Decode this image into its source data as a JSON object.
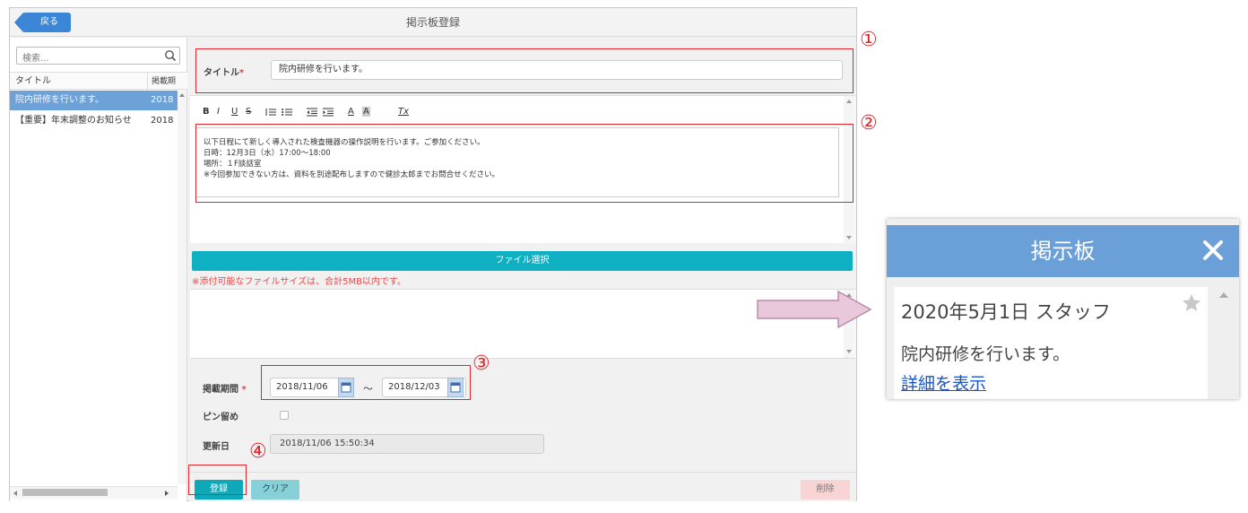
{
  "window": {
    "title": "掲示板登録",
    "back_label": "戻る"
  },
  "left_panel": {
    "search_placeholder": "検索...",
    "columns": [
      "タイトル",
      "掲載期"
    ],
    "rows": [
      {
        "title": "院内研修を行います。",
        "date": "2018",
        "selected": true
      },
      {
        "title": "【重要】年末調整のお知らせ",
        "date": "2018",
        "selected": false
      }
    ]
  },
  "form": {
    "title_label": "タイトル",
    "required_mark": "*",
    "title_value": "院内研修を行います。",
    "toolbar": [
      "B",
      "I",
      "U",
      "S",
      "list-ordered",
      "list-bullet",
      "outdent",
      "indent",
      "A",
      "A",
      "Tx"
    ],
    "body_lines": [
      "以下日程にて新しく導入された検査機器の操作説明を行います。ご参加ください。",
      "日時：12月3日（水）17:00～18:00",
      "場所：１F談話室",
      "※今回参加できない方は、資料を別途配布しますので健診太郎までお問合せください。"
    ],
    "file_button": "ファイル選択",
    "file_note": "※添付可能なファイルサイズは、合計5MB以内です。",
    "period_label": "掲載期間",
    "period_start": "2018/11/06",
    "period_sep": "～",
    "period_end": "2018/12/03",
    "pin_label": "ピン留め",
    "pin_checked": false,
    "updated_label": "更新日",
    "updated_value": "2018/11/06 15:50:34"
  },
  "buttons": {
    "register": "登録",
    "clear": "クリア",
    "delete": "削除"
  },
  "annotations": [
    "①",
    "②",
    "③",
    "④"
  ],
  "preview": {
    "title": "掲示板",
    "date_line": "2020年5月1日 スタッフ",
    "body": "院内研修を行います。",
    "link": "詳細を表示"
  },
  "colors": {
    "accent_blue": "#3b86d6",
    "teal": "#0fb0c2",
    "annotation_red": "#e0262b",
    "preview_header": "#6b9fd8",
    "arrow_fill": "#e8c8da"
  }
}
